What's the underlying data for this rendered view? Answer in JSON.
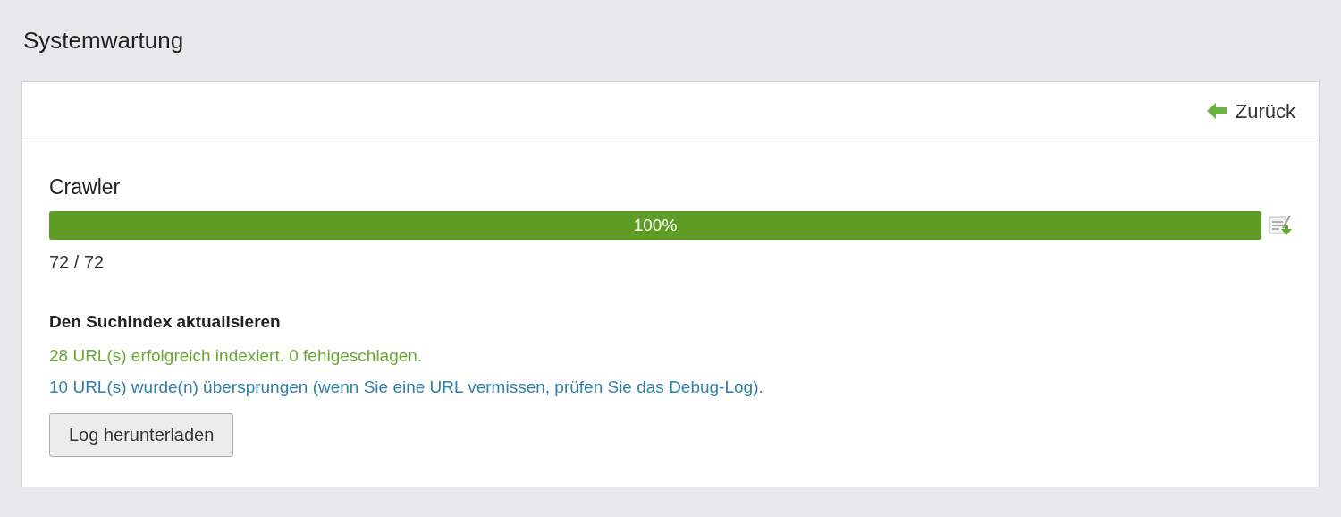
{
  "page_title": "Systemwartung",
  "back_link": {
    "label": "Zurück"
  },
  "crawler": {
    "title": "Crawler",
    "progress": {
      "level": 1,
      "label": "100%"
    },
    "count": "72 / 72"
  },
  "index_update": {
    "title": "Den Suchindex aktualisieren",
    "messages": [
      {
        "kind": "success",
        "text": "28 URL(s) erfolgreich indexiert. 0 fehlgeschlagen."
      },
      {
        "kind": "info",
        "text": "10 URL(s) wurde(n) übersprungen (wenn Sie eine URL vermissen, prüfen Sie das Debug-Log)."
      }
    ],
    "button": "Log herunterladen"
  }
}
